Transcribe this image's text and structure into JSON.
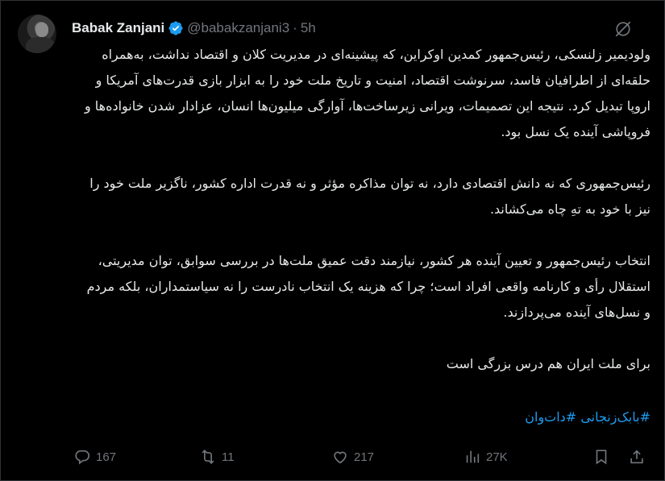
{
  "author": {
    "name": "Babak Zanjani",
    "handle": "@babakzanjani3",
    "separator": "·",
    "time": "5h",
    "verified_color": "#1d9bf0"
  },
  "tweet": {
    "paragraphs": [
      "ولودیمیر زلنسکی، رئیس‌جمهور کمدین اوکراین، که پیشینه‌ای در مدیریت کلان و اقتصاد نداشت، به‌همراه حلقه‌ای از اطرافیان فاسد، سرنوشت اقتصاد، امنیت و تاریخ ملت خود را به ابزار بازی قدرت‌های آمریکا و اروپا تبدیل کرد. نتیجه این تصمیمات، ویرانی زیرساخت‌ها، آوارگی میلیون‌ها انسان، عزادار شدن خانواده‌ها و فروپاشی آینده یک نسل بود.",
      "رئیس‌جمهوری که نه دانش اقتصادی دارد، نه توان مذاکره مؤثر و نه قدرت اداره کشور، ناگزیر ملت خود را نیز با خود به تهِ چاه می‌کشاند.",
      "انتخاب رئیس‌جمهور و تعیین آینده هر کشور، نیازمند دقت عمیق ملت‌ها در بررسی سوابق، توان مدیریتی، استقلال رأی و کارنامه واقعی افراد است؛ چرا که هزینه یک انتخاب نادرست را نه سیاستمداران، بلکه مردم و نسل‌های آینده می‌پردازند.",
      "برای ملت ایران هم درس بزرگی است"
    ],
    "hashtags": [
      "#بابک‌زنجانی",
      "#دات‌وان"
    ]
  },
  "actions": {
    "replies": "167",
    "reposts": "11",
    "likes": "217",
    "views": "27K"
  },
  "colors": {
    "background": "#000000",
    "text": "#e7e9ea",
    "muted": "#71767b",
    "link": "#1d9bf0",
    "border": "#2f3336"
  }
}
